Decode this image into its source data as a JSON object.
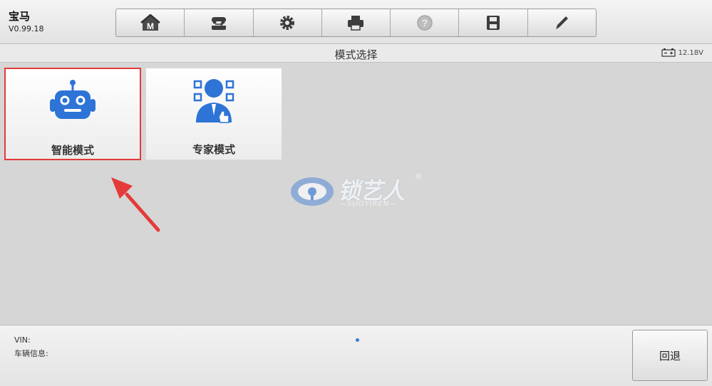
{
  "header": {
    "brand_name": "宝马",
    "version": "V0.99.18"
  },
  "toolbar": {
    "buttons": [
      {
        "icon": "home-m-icon"
      },
      {
        "icon": "vehicle-swap-icon"
      },
      {
        "icon": "gear-icon"
      },
      {
        "icon": "printer-icon"
      },
      {
        "icon": "help-icon"
      },
      {
        "icon": "save-icon"
      },
      {
        "icon": "pen-icon"
      }
    ]
  },
  "titlebar": {
    "title": "模式选择",
    "battery_voltage": "12.18V"
  },
  "modes": [
    {
      "label": "智能模式",
      "icon": "robot-icon",
      "highlighted": true
    },
    {
      "label": "专家模式",
      "icon": "expert-icon",
      "highlighted": false
    }
  ],
  "watermark": {
    "text": "锁艺人",
    "registered": "®",
    "subtext": "—SUOYIREN—"
  },
  "footer": {
    "vin_label": "VIN:",
    "vehicle_info_label": "车辆信息:",
    "back_label": "回退"
  },
  "colors": {
    "accent_blue": "#3a7bd5",
    "highlight_red": "#e53a3a"
  }
}
